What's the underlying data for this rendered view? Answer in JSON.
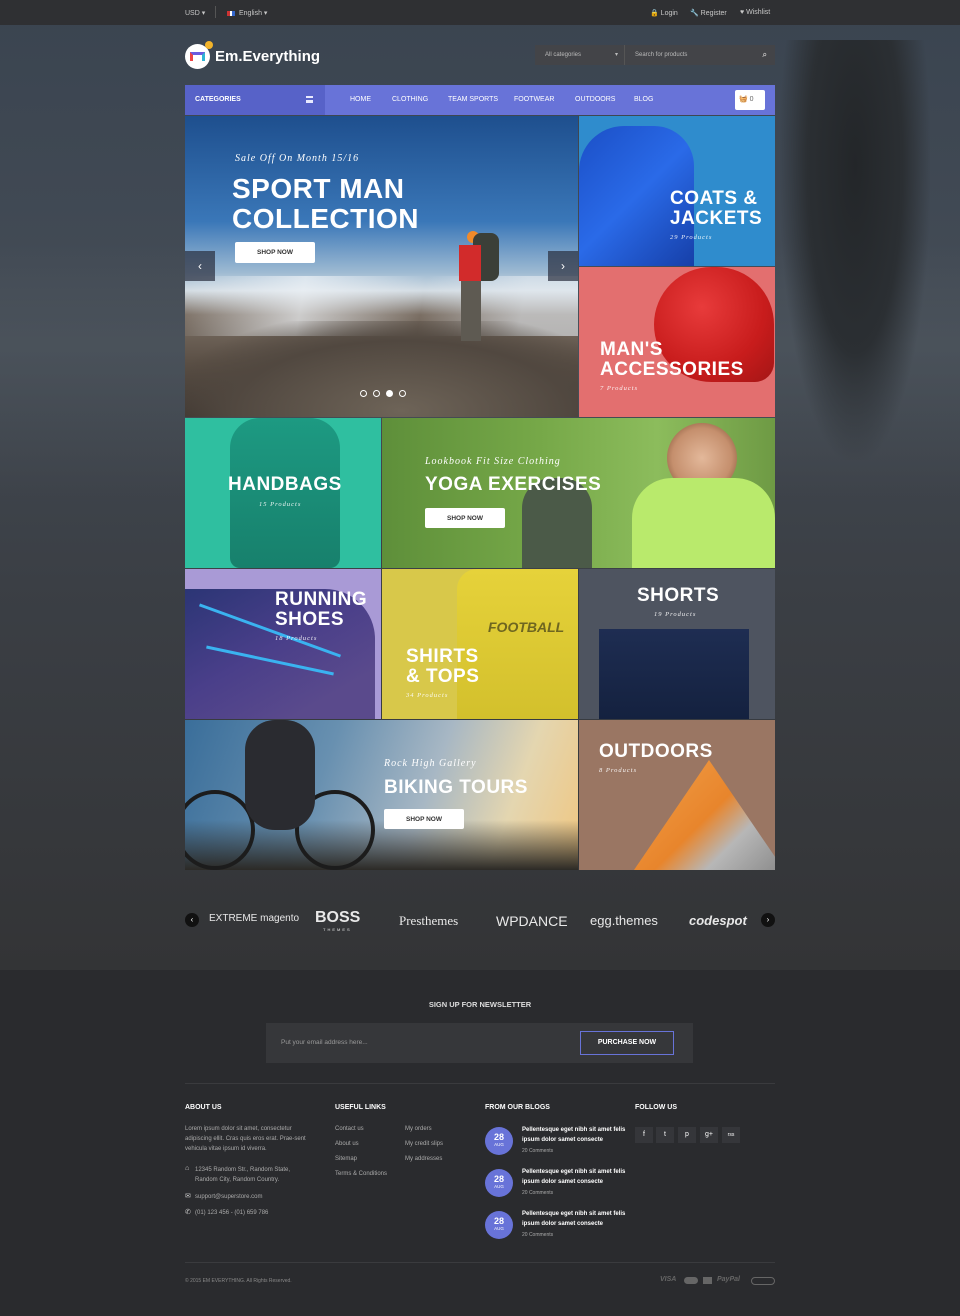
{
  "topbar": {
    "currency": "USD",
    "language": "English",
    "login": "Login",
    "register": "Register",
    "wishlist": "Wishlist"
  },
  "brand": {
    "name": "Em.Everything"
  },
  "search": {
    "category": "All categories",
    "placeholder": "Search for products"
  },
  "nav": {
    "categories_label": "CATEGORIES",
    "links": [
      "HOME",
      "CLOTHING",
      "TEAM SPORTS",
      "FOOTWEAR",
      "OUTDOORS",
      "BLOG"
    ],
    "cart_count": "0"
  },
  "hero": {
    "subtitle": "Sale Off On Month 15/16",
    "title_line1": "SPORT MAN",
    "title_line2": "COLLECTION",
    "button": "SHOP NOW"
  },
  "tiles": {
    "coats": {
      "line1": "COATS &",
      "line2": "JACKETS",
      "count": "29 Products"
    },
    "accessories": {
      "line1": "MAN'S",
      "line2": "ACCESSORIES",
      "count": "7 Products"
    },
    "handbags": {
      "line1": "HANDBAGS",
      "count": "15 Products"
    },
    "yoga": {
      "subtitle": "Lookbook Fit Size Clothing",
      "title": "YOGA EXERCISES",
      "button": "SHOP NOW"
    },
    "running": {
      "line1": "RUNNING",
      "line2": "SHOES",
      "count": "18 Products"
    },
    "shirts": {
      "line1": "SHIRTS",
      "line2": "& TOPS",
      "count": "34 Products",
      "print": "FOOTBALL"
    },
    "shorts": {
      "line1": "SHORTS",
      "count": "19 Products"
    },
    "biking": {
      "subtitle": "Rock High Gallery",
      "title": "BIKING TOURS",
      "button": "SHOP NOW"
    },
    "outdoors": {
      "line1": "OUTDOORS",
      "count": "8 Products"
    }
  },
  "brands": [
    "EXTREME magento",
    "BOSS",
    "Presthemes",
    "WPDANCE",
    "egg.themes",
    "codespot"
  ],
  "brands_sub": {
    "boss": "THEMES"
  },
  "newsletter": {
    "title": "SIGN UP FOR NEWSLETTER",
    "placeholder": "Put your email address here...",
    "button": "PURCHASE NOW"
  },
  "footer": {
    "about": {
      "title": "ABOUT US",
      "text": "Lorem ipsum dolor sit amet, consectetur adipiscing ellit. Cras quis eros erat. Prae-sent vehicula vitae ipsum id viverra.",
      "address": "12345 Random Str., Random State, Random City, Random Country.",
      "email": "support@superstore.com",
      "phone": "(01) 123 456 - (01) 659 786"
    },
    "links": {
      "title": "USEFUL LINKS",
      "col1": [
        "Contact us",
        "About us",
        "Sitemap",
        "Terms & Conditions"
      ],
      "col2": [
        "My orders",
        "My credit slips",
        "My addresses"
      ]
    },
    "blogs": {
      "title": "FROM OUR BLOGS",
      "posts": [
        {
          "day": "28",
          "month": "AUG",
          "text": "Pellentesque eget nibh sit amet felis ipsum dolor samet consecte",
          "comments": "20 Comments"
        },
        {
          "day": "28",
          "month": "AUG",
          "text": "Pellentesque eget nibh sit amet felis ipsum dolor samet consecte",
          "comments": "20 Comments"
        },
        {
          "day": "28",
          "month": "AUG",
          "text": "Pellentesque eget nibh sit amet felis ipsum dolor samet consecte",
          "comments": "20 Comments"
        }
      ]
    },
    "follow": {
      "title": "FOLLOW US",
      "icons": [
        "f",
        "t",
        "p",
        "g+",
        "rss"
      ]
    },
    "copyright": "© 2015 EM EVERYTHING. All Rights Reserved.",
    "payments": [
      "VISA",
      "PayPal"
    ]
  },
  "colors": {
    "accent": "#6873d8",
    "background": "#2a2b2e"
  }
}
